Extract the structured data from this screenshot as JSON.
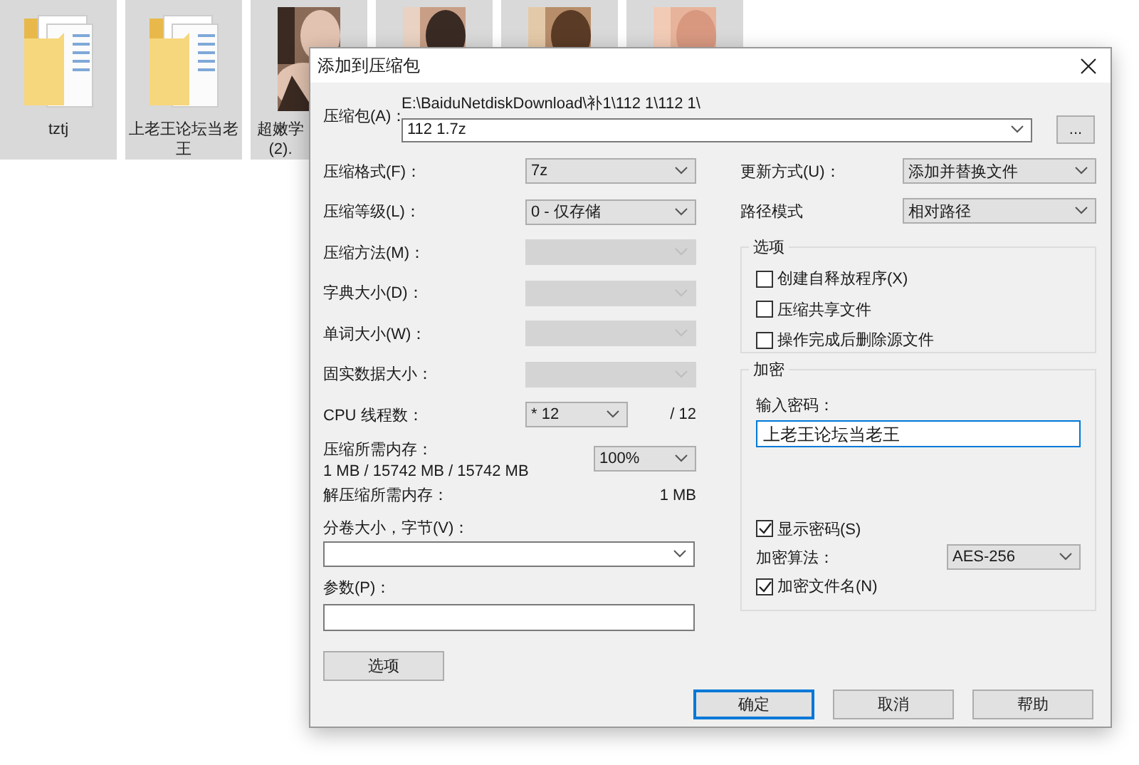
{
  "desktop": {
    "items": [
      {
        "kind": "folder",
        "label_lines": [
          "tztj"
        ],
        "selected": true
      },
      {
        "kind": "folder",
        "label_lines": [
          "上老王论坛当老",
          "王"
        ],
        "selected": true
      },
      {
        "kind": "picture",
        "label_lines": [
          "超嫩学",
          "(2)."
        ],
        "selected": true
      },
      {
        "kind": "picture",
        "selected": true
      },
      {
        "kind": "picture",
        "selected": true
      },
      {
        "kind": "picture",
        "selected": true
      }
    ]
  },
  "dialog": {
    "title": "添加到压缩包",
    "archive": {
      "label": "压缩包(A)：",
      "path": "E:\\BaiduNetdiskDownload\\补1\\112 1\\112 1\\",
      "value": "112 1.7z",
      "browse": "..."
    },
    "left_rows": [
      {
        "kind": "select",
        "label": "压缩格式(F)：",
        "value": "7z",
        "disabled": false
      },
      {
        "kind": "select",
        "label": "压缩等级(L)：",
        "value": "0 - 仅存储",
        "disabled": false
      },
      {
        "kind": "select",
        "label": "压缩方法(M)：",
        "disabled": true
      },
      {
        "kind": "select",
        "label": "字典大小(D)：",
        "disabled": true
      },
      {
        "kind": "select",
        "label": "单词大小(W)：",
        "disabled": true
      },
      {
        "kind": "select",
        "label": "固实数据大小：",
        "disabled": true
      },
      {
        "kind": "threads",
        "label": "CPU 线程数：",
        "value": "* 12",
        "suffix": "/ 12"
      },
      {
        "kind": "memory",
        "label": "压缩所需内存：",
        "detail": "1 MB / 15742 MB / 15742 MB",
        "value": "100%"
      },
      {
        "kind": "info",
        "label": "解压缩所需内存：",
        "value": "1 MB"
      }
    ],
    "volume": {
      "label": "分卷大小，字节(V)："
    },
    "params": {
      "label": "参数(P)："
    },
    "options_button": "选项",
    "right_rows": [
      {
        "label": "更新方式(U)：",
        "value": "添加并替换文件"
      },
      {
        "label": "路径模式",
        "value": "相对路径"
      }
    ],
    "options_group": {
      "title": "选项",
      "items": [
        {
          "label": "创建自释放程序(X)",
          "checked": false
        },
        {
          "label": "压缩共享文件",
          "checked": false
        },
        {
          "label": "操作完成后删除源文件",
          "checked": false
        }
      ]
    },
    "encryption": {
      "title": "加密",
      "password_label": "输入密码：",
      "password": "上老王论坛当老王",
      "show_password": {
        "label": "显示密码(S)",
        "checked": true
      },
      "method_label": "加密算法：",
      "method": "AES-256",
      "encrypt_names": {
        "label": "加密文件名(N)",
        "checked": true
      }
    },
    "buttons": [
      {
        "label": "确定",
        "default": true
      },
      {
        "label": "取消",
        "default": false
      },
      {
        "label": "帮助",
        "default": false
      }
    ]
  }
}
